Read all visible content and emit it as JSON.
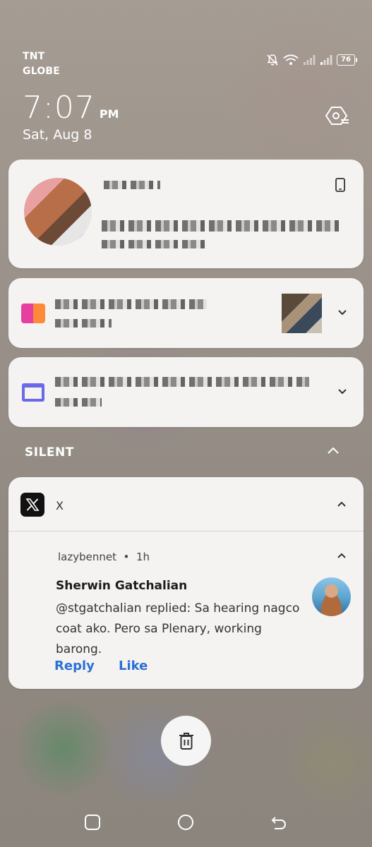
{
  "statusbar": {
    "carrier_1": "TNT",
    "carrier_2": "GLOBE",
    "battery": "76",
    "icons": [
      "bell-off-icon",
      "wifi-icon",
      "signal-icon",
      "signal-icon"
    ]
  },
  "lockclock": {
    "time": "7:07",
    "ampm": "PM",
    "date": "Sat, Aug 8"
  },
  "notifications": {
    "silent_label": "SILENT",
    "x_notification": {
      "app_name": "X",
      "username": "lazybennet",
      "age": "1h",
      "sender": "Sherwin Gatchalian",
      "message": "@stgatchalian replied: Sa hearing nagco coat ako. Pero sa Plenary, working barong.",
      "actions": [
        "Reply",
        "Like"
      ]
    }
  },
  "colors": {
    "accent": "#2c6fd6",
    "card_bg": "#f4f3f2"
  }
}
